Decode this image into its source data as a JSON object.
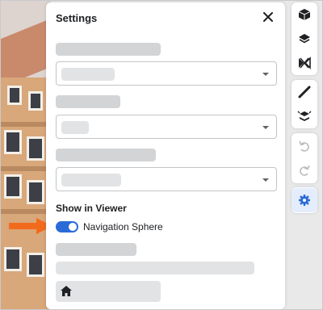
{
  "settings": {
    "title": "Settings",
    "close_icon": "close-icon",
    "show_in_viewer_label": "Show in Viewer",
    "navigation_sphere_label": "Navigation Sphere",
    "navigation_sphere_enabled": true,
    "home_icon": "home-icon"
  },
  "toolbar": {
    "groups": [
      [
        "cube-icon",
        "layers-icon",
        "section-icon"
      ],
      [
        "measure-icon",
        "explode-icon"
      ],
      [
        "undo-icon",
        "redo-icon"
      ],
      [
        "gear-icon"
      ]
    ]
  },
  "colors": {
    "accent": "#2b6bd8",
    "arrow": "#f26b1d",
    "skeleton": "#d3d4d6"
  }
}
